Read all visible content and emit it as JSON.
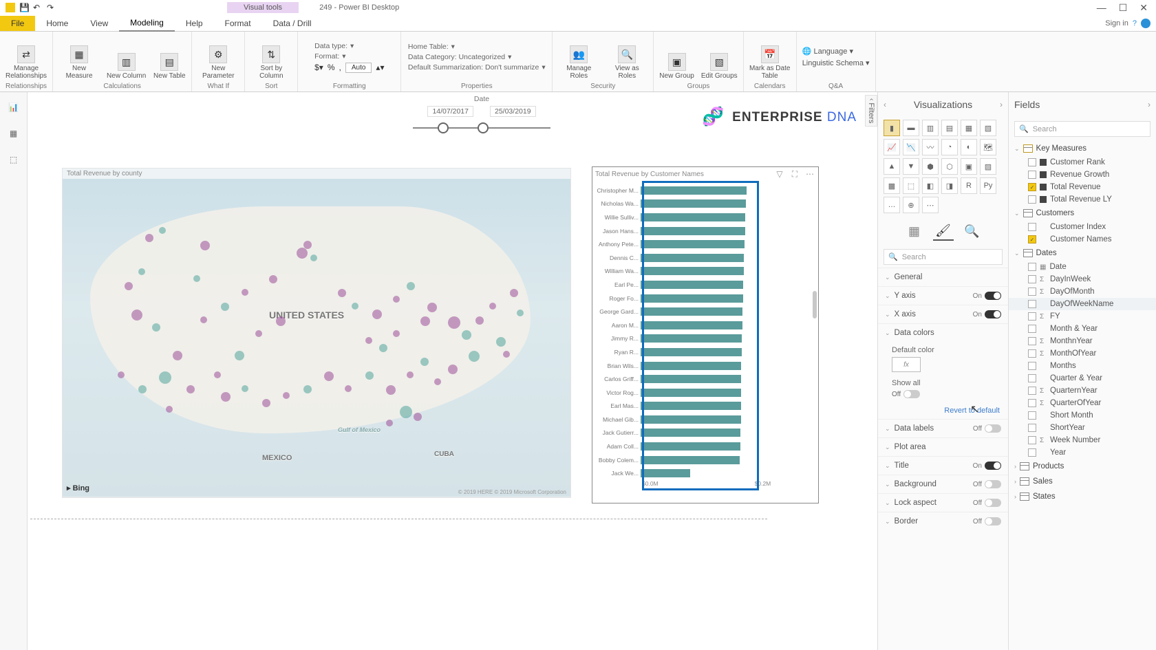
{
  "app": {
    "title": "249 - Power BI Desktop",
    "visual_tools": "Visual tools",
    "signin": "Sign in"
  },
  "tabs": {
    "file": "File",
    "list": [
      "Home",
      "View",
      "Modeling",
      "Help",
      "Format",
      "Data / Drill"
    ],
    "active": "Modeling"
  },
  "ribbon": {
    "relationships": {
      "manage": "Manage\nRelationships",
      "group": "Relationships"
    },
    "calculations": {
      "measure": "New\nMeasure",
      "column": "New\nColumn",
      "table": "New\nTable",
      "group": "Calculations"
    },
    "whatif": {
      "param": "New\nParameter",
      "group": "What If"
    },
    "sort": {
      "sortby": "Sort by\nColumn",
      "group": "Sort"
    },
    "formatting": {
      "datatype": "Data type:",
      "format": "Format:",
      "auto": "Auto",
      "group": "Formatting"
    },
    "properties": {
      "hometable": "Home Table:",
      "datacat": "Data Category: Uncategorized",
      "defsum": "Default Summarization: Don't summarize",
      "group": "Properties"
    },
    "security": {
      "manage": "Manage\nRoles",
      "viewas": "View as\nRoles",
      "group": "Security"
    },
    "groups": {
      "new": "New\nGroup",
      "edit": "Edit\nGroups",
      "group": "Groups"
    },
    "calendars": {
      "mark": "Mark as\nDate Table",
      "group": "Calendars"
    },
    "qa": {
      "lang": "Language",
      "schema": "Linguistic Schema",
      "group": "Q&A"
    }
  },
  "slicer": {
    "label": "Date",
    "start": "14/07/2017",
    "end": "25/03/2019"
  },
  "logo": {
    "text": "ENTERPRISE ",
    "dna": "DNA"
  },
  "map": {
    "title": "Total Revenue by county",
    "country": "UNITED STATES",
    "mexico": "MEXICO",
    "cuba": "CUBA",
    "gulf": "Gulf of Mexico",
    "bing": "Bing",
    "copyright": "© 2019 HERE © 2019 Microsoft Corporation"
  },
  "barchart": {
    "title": "Total Revenue by Customer Names",
    "xaxis": [
      "$0.0M",
      "$0.2M"
    ]
  },
  "chart_data": {
    "type": "bar",
    "title": "Total Revenue by Customer Names",
    "xlabel": "Total Revenue",
    "ylabel": "Customer Names",
    "xlim": [
      0,
      0.2
    ],
    "unit": "$M",
    "categories": [
      "Christopher M...",
      "Nicholas Wa...",
      "Willie Sulliv...",
      "Jason Hans...",
      "Anthony Pete...",
      "Dennis C...",
      "William Wa...",
      "Earl Pe...",
      "Roger Fo...",
      "George Gard...",
      "Aaron M...",
      "Jimmy R...",
      "Ryan R...",
      "Brian Wils...",
      "Carlos Griff...",
      "Victor Rog...",
      "Earl Mas...",
      "Michael Gib...",
      "Jack Gutierr...",
      "Adam Coll...",
      "Bobby Colem...",
      "Jack We..."
    ],
    "values": [
      0.193,
      0.191,
      0.19,
      0.19,
      0.189,
      0.188,
      0.187,
      0.186,
      0.186,
      0.185,
      0.185,
      0.184,
      0.184,
      0.183,
      0.183,
      0.183,
      0.182,
      0.182,
      0.181,
      0.181,
      0.18,
      0.09
    ]
  },
  "viz_pane": {
    "header": "Visualizations",
    "search": "Search",
    "format_sections": [
      {
        "name": "General",
        "state": null
      },
      {
        "name": "Y axis",
        "state": "On"
      },
      {
        "name": "X axis",
        "state": "On"
      },
      {
        "name": "Data colors",
        "state": null,
        "expanded": true
      },
      {
        "name": "Data labels",
        "state": "Off"
      },
      {
        "name": "Plot area",
        "state": null
      },
      {
        "name": "Title",
        "state": "On"
      },
      {
        "name": "Background",
        "state": "Off"
      },
      {
        "name": "Lock aspect",
        "state": "Off"
      },
      {
        "name": "Border",
        "state": "Off"
      }
    ],
    "default_color": "Default color",
    "fx": "fx",
    "show_all": "Show all",
    "show_all_state": "Off",
    "revert": "Revert to default"
  },
  "fields_pane": {
    "header": "Fields",
    "search": "Search",
    "tables": [
      {
        "name": "Key Measures",
        "type": "measures",
        "expanded": true,
        "fields": [
          {
            "name": "Customer Rank",
            "kind": "measure",
            "checked": false
          },
          {
            "name": "Revenue Growth",
            "kind": "measure",
            "checked": false
          },
          {
            "name": "Total Revenue",
            "kind": "measure",
            "checked": true
          },
          {
            "name": "Total Revenue LY",
            "kind": "measure",
            "checked": false
          }
        ]
      },
      {
        "name": "Customers",
        "type": "table",
        "expanded": true,
        "fields": [
          {
            "name": "Customer Index",
            "kind": "column",
            "checked": false
          },
          {
            "name": "Customer Names",
            "kind": "column",
            "checked": true
          }
        ]
      },
      {
        "name": "Dates",
        "type": "table",
        "expanded": true,
        "fields": [
          {
            "name": "Date",
            "kind": "hierarchy",
            "checked": false
          },
          {
            "name": "DayInWeek",
            "kind": "calc",
            "checked": false
          },
          {
            "name": "DayOfMonth",
            "kind": "calc",
            "checked": false
          },
          {
            "name": "DayOfWeekName",
            "kind": "column",
            "checked": false,
            "highlight": true
          },
          {
            "name": "FY",
            "kind": "calc",
            "checked": false
          },
          {
            "name": "Month & Year",
            "kind": "column",
            "checked": false
          },
          {
            "name": "MonthnYear",
            "kind": "calc",
            "checked": false
          },
          {
            "name": "MonthOfYear",
            "kind": "calc",
            "checked": false
          },
          {
            "name": "Months",
            "kind": "column",
            "checked": false
          },
          {
            "name": "Quarter & Year",
            "kind": "column",
            "checked": false
          },
          {
            "name": "QuarternYear",
            "kind": "calc",
            "checked": false
          },
          {
            "name": "QuarterOfYear",
            "kind": "calc",
            "checked": false
          },
          {
            "name": "Short Month",
            "kind": "column",
            "checked": false
          },
          {
            "name": "ShortYear",
            "kind": "column",
            "checked": false
          },
          {
            "name": "Week Number",
            "kind": "calc",
            "checked": false
          },
          {
            "name": "Year",
            "kind": "column",
            "checked": false
          }
        ]
      },
      {
        "name": "Products",
        "type": "table",
        "expanded": false
      },
      {
        "name": "Sales",
        "type": "table",
        "expanded": false
      },
      {
        "name": "States",
        "type": "table",
        "expanded": false
      }
    ]
  },
  "filters_label": "Filters"
}
